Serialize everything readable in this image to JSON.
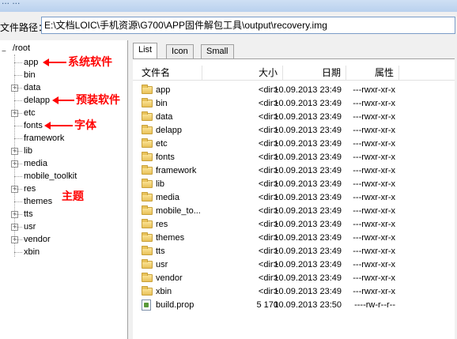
{
  "window": {
    "title_fragment": "... ..."
  },
  "pathbar": {
    "label": "文件路径：",
    "value": "E:\\文档LOIC\\手机资源\\G700\\APP固件解包工具\\output\\recovery.img"
  },
  "tree": {
    "root": "/root",
    "items": [
      {
        "label": "app",
        "expandable": false
      },
      {
        "label": "bin",
        "expandable": false
      },
      {
        "label": "data",
        "expandable": true
      },
      {
        "label": "delapp",
        "expandable": false
      },
      {
        "label": "etc",
        "expandable": true
      },
      {
        "label": "fonts",
        "expandable": false
      },
      {
        "label": "framework",
        "expandable": false
      },
      {
        "label": "lib",
        "expandable": true
      },
      {
        "label": "media",
        "expandable": true
      },
      {
        "label": "mobile_toolkit",
        "expandable": false
      },
      {
        "label": "res",
        "expandable": true
      },
      {
        "label": "themes",
        "expandable": false
      },
      {
        "label": "tts",
        "expandable": true
      },
      {
        "label": "usr",
        "expandable": true
      },
      {
        "label": "vendor",
        "expandable": true
      },
      {
        "label": "xbin",
        "expandable": false
      }
    ],
    "expand_glyph": "+"
  },
  "annotations": {
    "app": "系统软件",
    "delapp": "预装软件",
    "fonts": "字体",
    "themes": "主题",
    "color": "#ff0000"
  },
  "tabs": [
    {
      "label": "List",
      "active": true
    },
    {
      "label": "Icon",
      "active": false
    },
    {
      "label": "Small",
      "active": false
    }
  ],
  "columns": {
    "name": "文件名",
    "size": "大小",
    "date": "日期",
    "attr": "属性"
  },
  "files": [
    {
      "name": "app",
      "size": "<dir>",
      "date": "10.09.2013 23:49",
      "attr": "---rwxr-xr-x",
      "icon": "folder-icon"
    },
    {
      "name": "bin",
      "size": "<dir>",
      "date": "10.09.2013 23:49",
      "attr": "---rwxr-xr-x",
      "icon": "folder-icon"
    },
    {
      "name": "data",
      "size": "<dir>",
      "date": "10.09.2013 23:49",
      "attr": "---rwxr-xr-x",
      "icon": "folder-icon"
    },
    {
      "name": "delapp",
      "size": "<dir>",
      "date": "10.09.2013 23:49",
      "attr": "---rwxr-xr-x",
      "icon": "folder-icon"
    },
    {
      "name": "etc",
      "size": "<dir>",
      "date": "10.09.2013 23:49",
      "attr": "---rwxr-xr-x",
      "icon": "folder-icon"
    },
    {
      "name": "fonts",
      "size": "<dir>",
      "date": "10.09.2013 23:49",
      "attr": "---rwxr-xr-x",
      "icon": "folder-icon"
    },
    {
      "name": "framework",
      "size": "<dir>",
      "date": "10.09.2013 23:49",
      "attr": "---rwxr-xr-x",
      "icon": "folder-icon"
    },
    {
      "name": "lib",
      "size": "<dir>",
      "date": "10.09.2013 23:49",
      "attr": "---rwxr-xr-x",
      "icon": "folder-icon"
    },
    {
      "name": "media",
      "size": "<dir>",
      "date": "10.09.2013 23:49",
      "attr": "---rwxr-xr-x",
      "icon": "folder-icon"
    },
    {
      "name": "mobile_to...",
      "size": "<dir>",
      "date": "10.09.2013 23:49",
      "attr": "---rwxr-xr-x",
      "icon": "folder-icon"
    },
    {
      "name": "res",
      "size": "<dir>",
      "date": "10.09.2013 23:49",
      "attr": "---rwxr-xr-x",
      "icon": "folder-icon"
    },
    {
      "name": "themes",
      "size": "<dir>",
      "date": "10.09.2013 23:49",
      "attr": "---rwxr-xr-x",
      "icon": "folder-icon"
    },
    {
      "name": "tts",
      "size": "<dir>",
      "date": "10.09.2013 23:49",
      "attr": "---rwxr-xr-x",
      "icon": "folder-icon"
    },
    {
      "name": "usr",
      "size": "<dir>",
      "date": "10.09.2013 23:49",
      "attr": "---rwxr-xr-x",
      "icon": "folder-icon"
    },
    {
      "name": "vendor",
      "size": "<dir>",
      "date": "10.09.2013 23:49",
      "attr": "---rwxr-xr-x",
      "icon": "folder-icon"
    },
    {
      "name": "xbin",
      "size": "<dir>",
      "date": "10.09.2013 23:49",
      "attr": "---rwxr-xr-x",
      "icon": "folder-icon"
    },
    {
      "name": "build.prop",
      "size": "5 170",
      "date": "10.09.2013 23:50",
      "attr": "----rw-r--r--",
      "icon": "file-icon"
    }
  ]
}
